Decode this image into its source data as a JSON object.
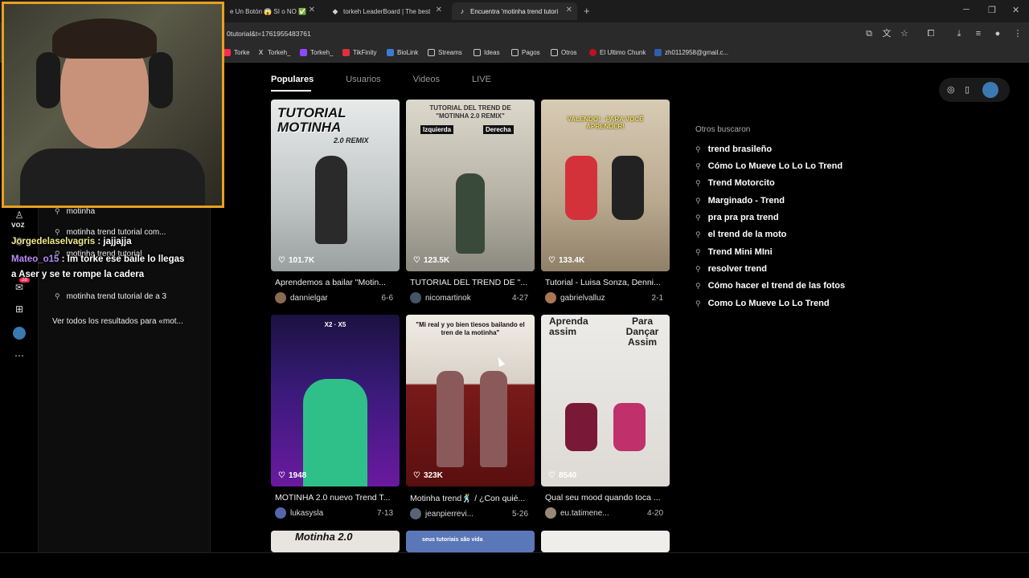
{
  "browser": {
    "tabs": [
      {
        "label": "e Un Botón 😱 SI o NO ✅ ",
        "active": false
      },
      {
        "label": "torkeh LeaderBoard | The best ",
        "active": false
      },
      {
        "label": "Encuentra 'motinha trend tutori",
        "active": true
      }
    ],
    "url": "0tutorial&t=1761955483761",
    "bookmarks": [
      "Torke",
      "Torkeh_",
      "Torkeh_",
      "TikFinity",
      "BioLink",
      "Streams",
      "Ideas",
      "Pagos",
      "Otros",
      "El Ultimo Chunk",
      "zh0112958@gmail.c..."
    ]
  },
  "leftrail": {
    "voz_label": "voz",
    "badge": "28"
  },
  "suggestions": {
    "items": [
      "motinha",
      "motinha trend tutorial com...",
      "motinha trend tutorial",
      "motinha trend tutorial de a 3"
    ],
    "see_all": "Ver todos los resultados para «mot..."
  },
  "chat_overlay": {
    "line1_user": "Jorgedelaselvagris",
    "line1_msg": " : jajjajja",
    "line2_user": "Mateo_o15",
    "line2_msg": " : lm torke ese baile lo llegas",
    "line3_msg": "a Aser y se te rompe la cadera"
  },
  "search_tabs": [
    "Populares",
    "Usuarios",
    "Videos",
    "LIVE"
  ],
  "videos": [
    {
      "likes": "101.7K",
      "caption": "Aprendemos a bailar \"Motin...",
      "user": "dannielgar",
      "date": "6-6",
      "overlay": "TUTORIAL MOTINHA",
      "overlay2": "2.0 REMIX",
      "bg": "#cfd3d4",
      "fg": "#2a2a2a",
      "avatar": "#8a6a50"
    },
    {
      "likes": "123.5K",
      "caption": "TUTORIAL DEL TREND DE \"...",
      "user": "nicomartinok",
      "date": "4-27",
      "overlay": "TUTORIAL DEL TREND DE \"MOTINHA 2.0 REMIX\"",
      "overlay2": "Izquierda · Derecha",
      "bg": "#c8c4b8",
      "fg": "#5a5a52",
      "avatar": "#445566"
    },
    {
      "likes": "133.4K",
      "caption": "Tutorial - Luisa Sonza, Denni...",
      "user": "gabrielvalluz",
      "date": "2-1",
      "overlay": "VALENDO! · PARA VOCÊ APRENDER!",
      "overlay2": "",
      "bg": "#c9b9a0",
      "fg": "#d3323a",
      "avatar": "#aa7755"
    },
    {
      "likes": "1948",
      "caption": "MOTINHA 2.0 nuevo Trend T...",
      "user": "lukasysla",
      "date": "7-13",
      "overlay": "X2 · X5",
      "overlay2": "",
      "bg": "#2a1550",
      "fg": "#3ec28a",
      "avatar": "#5566aa"
    },
    {
      "likes": "323K",
      "caption": "Motinha trend🕺 / ¿Con quié...",
      "user": "jeanpierrevi...",
      "date": "5-26",
      "overlay": "\"Mi real y yo bien tiesos bailando el tren de la motinha\"",
      "overlay2": "",
      "bg": "#6a1414",
      "fg": "#8a5a5a",
      "avatar": "#556677"
    },
    {
      "likes": "8540",
      "caption": "Qual seu mood quando toca ...",
      "user": "eu.tatimene...",
      "date": "4-20",
      "overlay": "Aprenda assim",
      "overlay2": "Para Dançar Assim",
      "bg": "#e6e3df",
      "fg": "#c0306a",
      "avatar": "#998877"
    }
  ],
  "bottom_previews": [
    "Motinha 2.0",
    "seus tutoriais são vida",
    ""
  ],
  "others_title": "Otros buscaron",
  "trends": [
    "trend brasileño",
    "Cómo Lo Mueve Lo Lo Lo Trend",
    "Trend Motorcito",
    "Marginado - Trend",
    "pra pra pra trend",
    "el trend de la moto",
    "Trend Mini MIni",
    "resolver trend",
    "Cómo hacer el trend de las fotos",
    "Como Lo Mueve Lo Lo Trend"
  ],
  "colors": {
    "accent": "#e8a020",
    "tiktok_red": "#fe2c55"
  }
}
